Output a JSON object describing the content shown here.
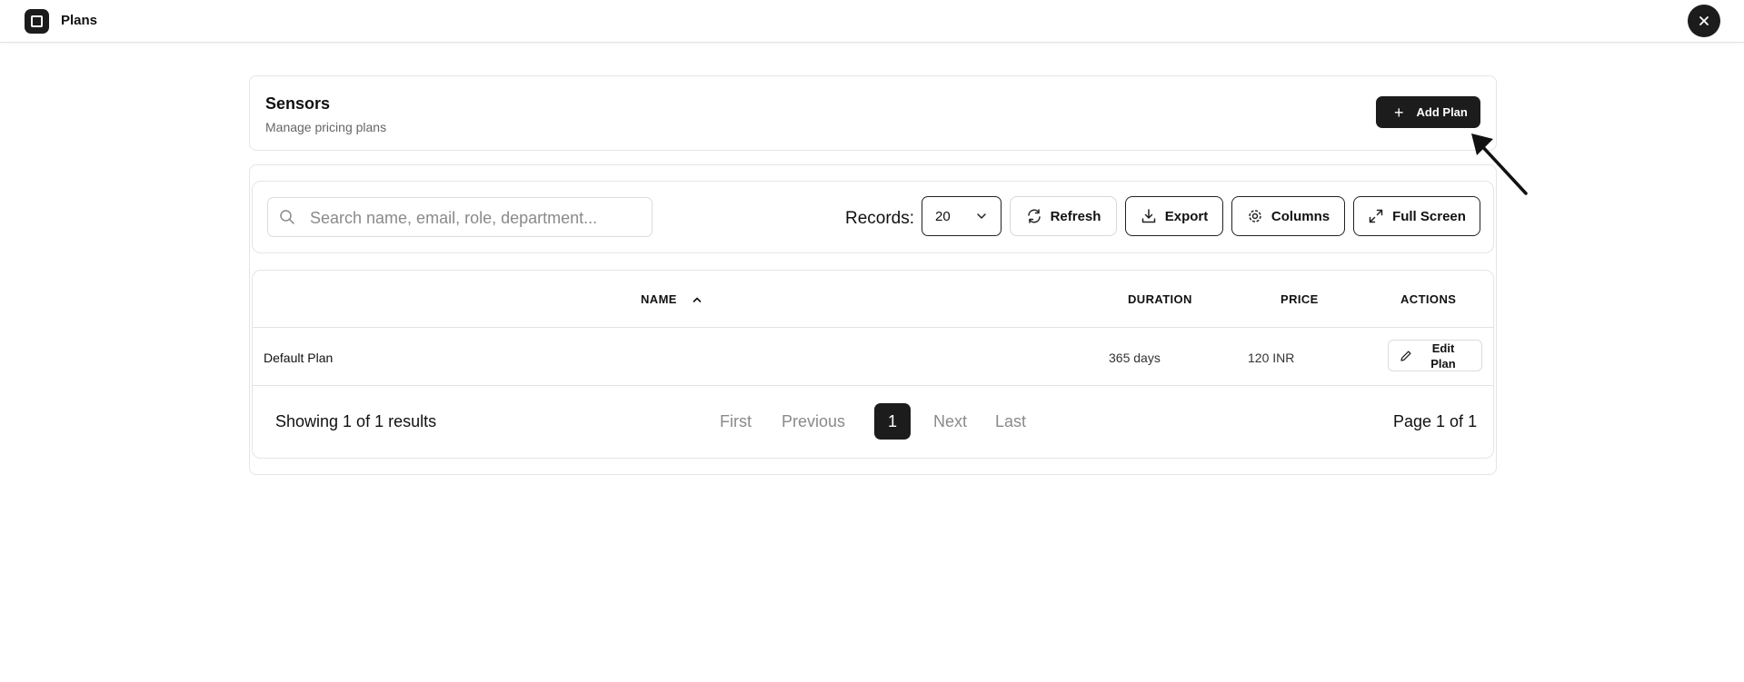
{
  "topbar": {
    "title": "Plans",
    "logo_icon": "square-logo-icon",
    "close_icon": "close-icon"
  },
  "header": {
    "title": "Sensors",
    "subtitle": "Manage pricing plans",
    "add_button": {
      "label": "Add Plan",
      "icon": "plus-icon"
    }
  },
  "toolbar": {
    "search_placeholder": "Search name, email, role, department...",
    "search_value": "",
    "records_label": "Records:",
    "records_value": "20",
    "refresh_label": "Refresh",
    "export_label": "Export",
    "columns_label": "Columns",
    "fullscreen_label": "Full Screen"
  },
  "table": {
    "columns": [
      {
        "key": "name",
        "label": "NAME",
        "sort": "ascending"
      },
      {
        "key": "duration",
        "label": "DURATION"
      },
      {
        "key": "price",
        "label": "PRICE"
      },
      {
        "key": "actions",
        "label": "ACTIONS"
      }
    ],
    "rows": [
      {
        "name": "Default Plan",
        "duration": "365 days",
        "price": "120 INR",
        "action_label_1": "Edit",
        "action_label_2": "Plan"
      }
    ]
  },
  "pagination": {
    "showing": "Showing 1 of 1 results",
    "first": "First",
    "previous": "Previous",
    "current": "1",
    "next": "Next",
    "last": "Last",
    "page_of": "Page 1 of 1"
  },
  "colors": {
    "primary": "#1c1c1c",
    "border": "#e5e5e5",
    "muted_text": "#8a8a8a"
  }
}
